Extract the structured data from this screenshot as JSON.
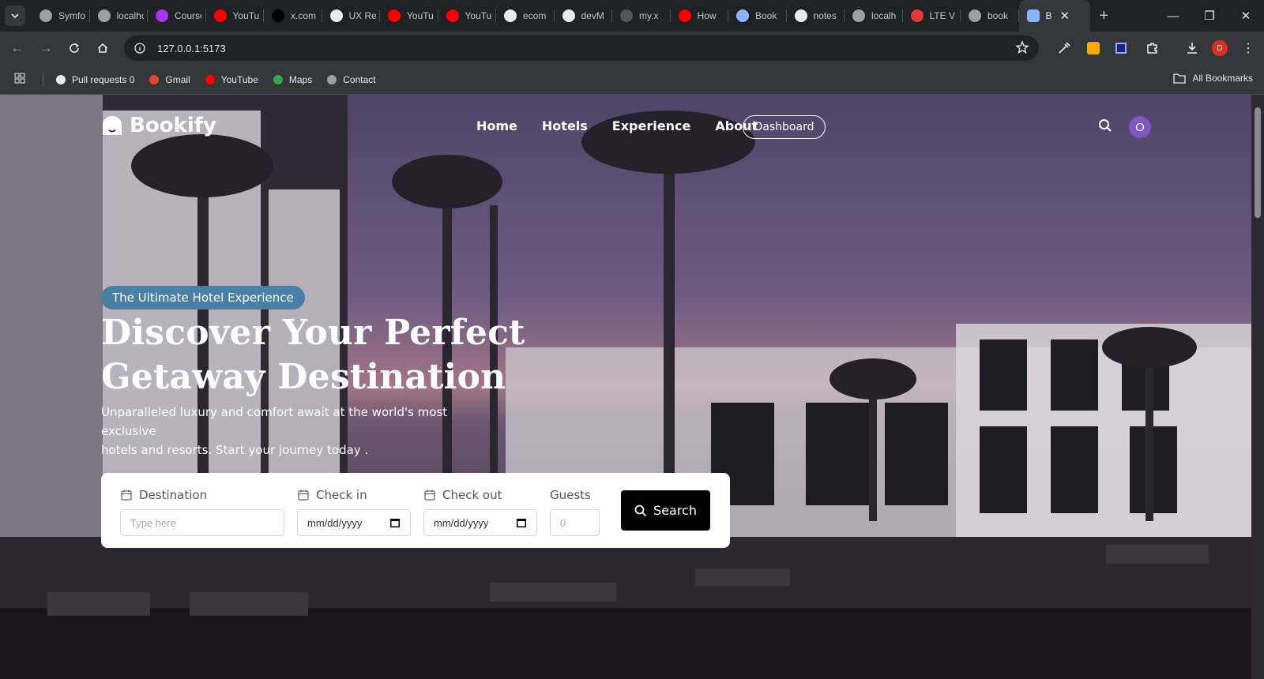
{
  "browser": {
    "tabs": [
      {
        "label": "Symfony",
        "icon": "globe-icon",
        "color": "#9aa0a6"
      },
      {
        "label": "localhost",
        "icon": "globe-icon",
        "color": "#9aa0a6"
      },
      {
        "label": "Courses",
        "icon": "udemy-icon",
        "color": "#a435f0"
      },
      {
        "label": "YouTube",
        "icon": "youtube-icon",
        "color": "#ff0000"
      },
      {
        "label": "x.com",
        "icon": "x-icon",
        "color": "#000000"
      },
      {
        "label": "UX Re",
        "icon": "doc-icon",
        "color": "#e8eaed"
      },
      {
        "label": "YouTube",
        "icon": "youtube-icon",
        "color": "#ff0000"
      },
      {
        "label": "YouTube",
        "icon": "youtube-icon",
        "color": "#ff0000"
      },
      {
        "label": "ecom",
        "icon": "github-icon",
        "color": "#e8eaed"
      },
      {
        "label": "devM",
        "icon": "github-icon",
        "color": "#e8eaed"
      },
      {
        "label": "my.x",
        "icon": "x-icon",
        "color": "#555"
      },
      {
        "label": "How",
        "icon": "youtube-icon",
        "color": "#ff0000"
      },
      {
        "label": "Book",
        "icon": "bookify-icon",
        "color": "#8ab4f8"
      },
      {
        "label": "notes",
        "icon": "github-icon",
        "color": "#e8eaed"
      },
      {
        "label": "localh",
        "icon": "globe-icon",
        "color": "#9aa0a6"
      },
      {
        "label": "LTE V",
        "icon": "lte-icon",
        "color": "#e53935"
      },
      {
        "label": "book",
        "icon": "globe-icon",
        "color": "#9aa0a6"
      }
    ],
    "active_tab": {
      "label": "B",
      "icon": "bookify-icon"
    },
    "url": "127.0.0.1:5173",
    "bookmarks": [
      {
        "label": "Pull requests 0",
        "icon": "github-icon"
      },
      {
        "label": "Gmail",
        "icon": "gmail-icon"
      },
      {
        "label": "YouTube",
        "icon": "youtube-icon"
      },
      {
        "label": "Maps",
        "icon": "maps-icon"
      },
      {
        "label": "Contact",
        "icon": "globe-icon"
      }
    ],
    "all_bookmarks": "All Bookmarks",
    "profile_initial": "D"
  },
  "site": {
    "brand": "Bookify",
    "nav": [
      "Home",
      "Hotels",
      "Experience",
      "About"
    ],
    "dashboard": "Dashboard",
    "user_initial": "O"
  },
  "hero": {
    "badge": "The Ultimate Hotel Experience",
    "title_line1": "Discover Your Perfect",
    "title_line2": "Getaway Destination",
    "subtitle_line1": "Unparalleled luxury and comfort await at the world's most exclusive",
    "subtitle_line2": "hotels and resorts. Start your journey today ."
  },
  "search": {
    "destination_label": "Destination",
    "destination_placeholder": "Type here",
    "checkin_label": "Check in",
    "checkin_value": "mm/dd/yyyy",
    "checkout_label": "Check out",
    "checkout_value": "mm/dd/yyyy",
    "guests_label": "Guests",
    "guests_placeholder": "0",
    "button": "Search"
  },
  "colors": {
    "badge": "#4a7fa6",
    "avatar": "#7e57c2",
    "search_button": "#000000"
  }
}
